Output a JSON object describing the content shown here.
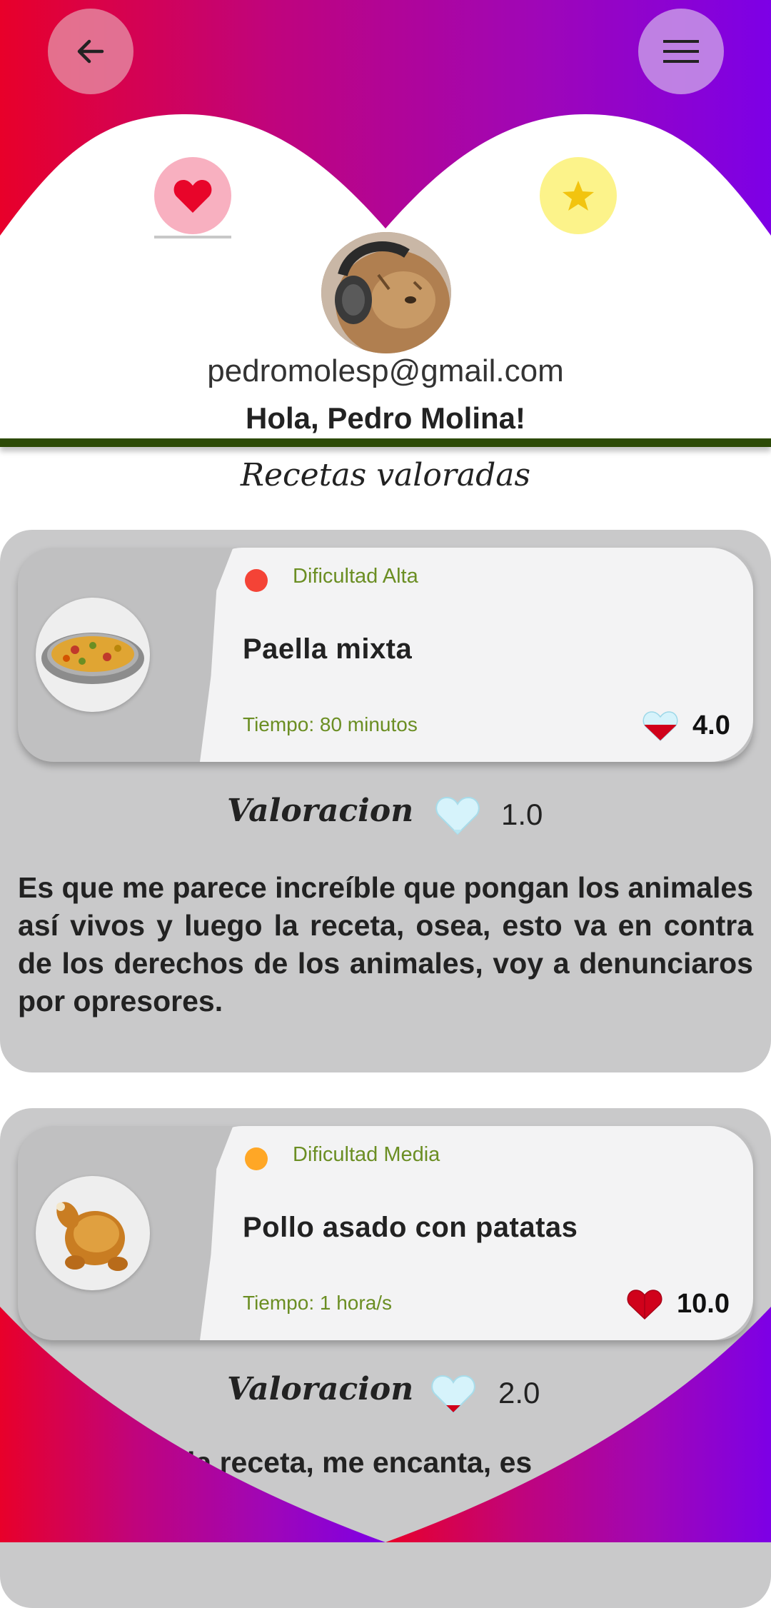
{
  "header": {
    "back_icon": "arrow-left-icon",
    "menu_icon": "hamburger-menu-icon",
    "favorites_tab_icon": "heart-icon",
    "starred_tab_icon": "star-icon",
    "email": "pedromolesp@gmail.com",
    "greeting": "Hola, Pedro Molina!"
  },
  "section_title": "Recetas valoradas",
  "colors": {
    "gradient_start": "#e8002a",
    "gradient_end": "#7d00e6",
    "divider": "#2c4a06",
    "difficulty_high": "#f44336",
    "difficulty_medium": "#ffa726",
    "difficulty_text": "#6b8e23"
  },
  "reviews": [
    {
      "difficulty": "Dificultad Alta",
      "difficulty_color": "#f44336",
      "name": "Paella mixta",
      "time": "Tiempo: 80 minutos",
      "avg_rating": "4.0",
      "avg_fill": 0.4,
      "rating_label": "Valoracion",
      "user_rating": "1.0",
      "user_fill": 0.1,
      "comment": "Es que me parece increíble que pongan los animales así vivos y luego la receta, osea, esto va en contra de los derechos de los animales, voy a denunciaros por opresores.",
      "dish_icon": "paella-icon"
    },
    {
      "difficulty": "Dificultad Media",
      "difficulty_color": "#ffa726",
      "name": "Pollo asado con patatas",
      "time": "Tiempo: 1 hora/s",
      "avg_rating": "10.0",
      "avg_fill": 1.0,
      "rating_label": "Valoracion",
      "user_rating": "2.0",
      "user_fill": 0.2,
      "comment": "la receta, me encanta, es",
      "dish_icon": "roast-chicken-icon"
    }
  ]
}
